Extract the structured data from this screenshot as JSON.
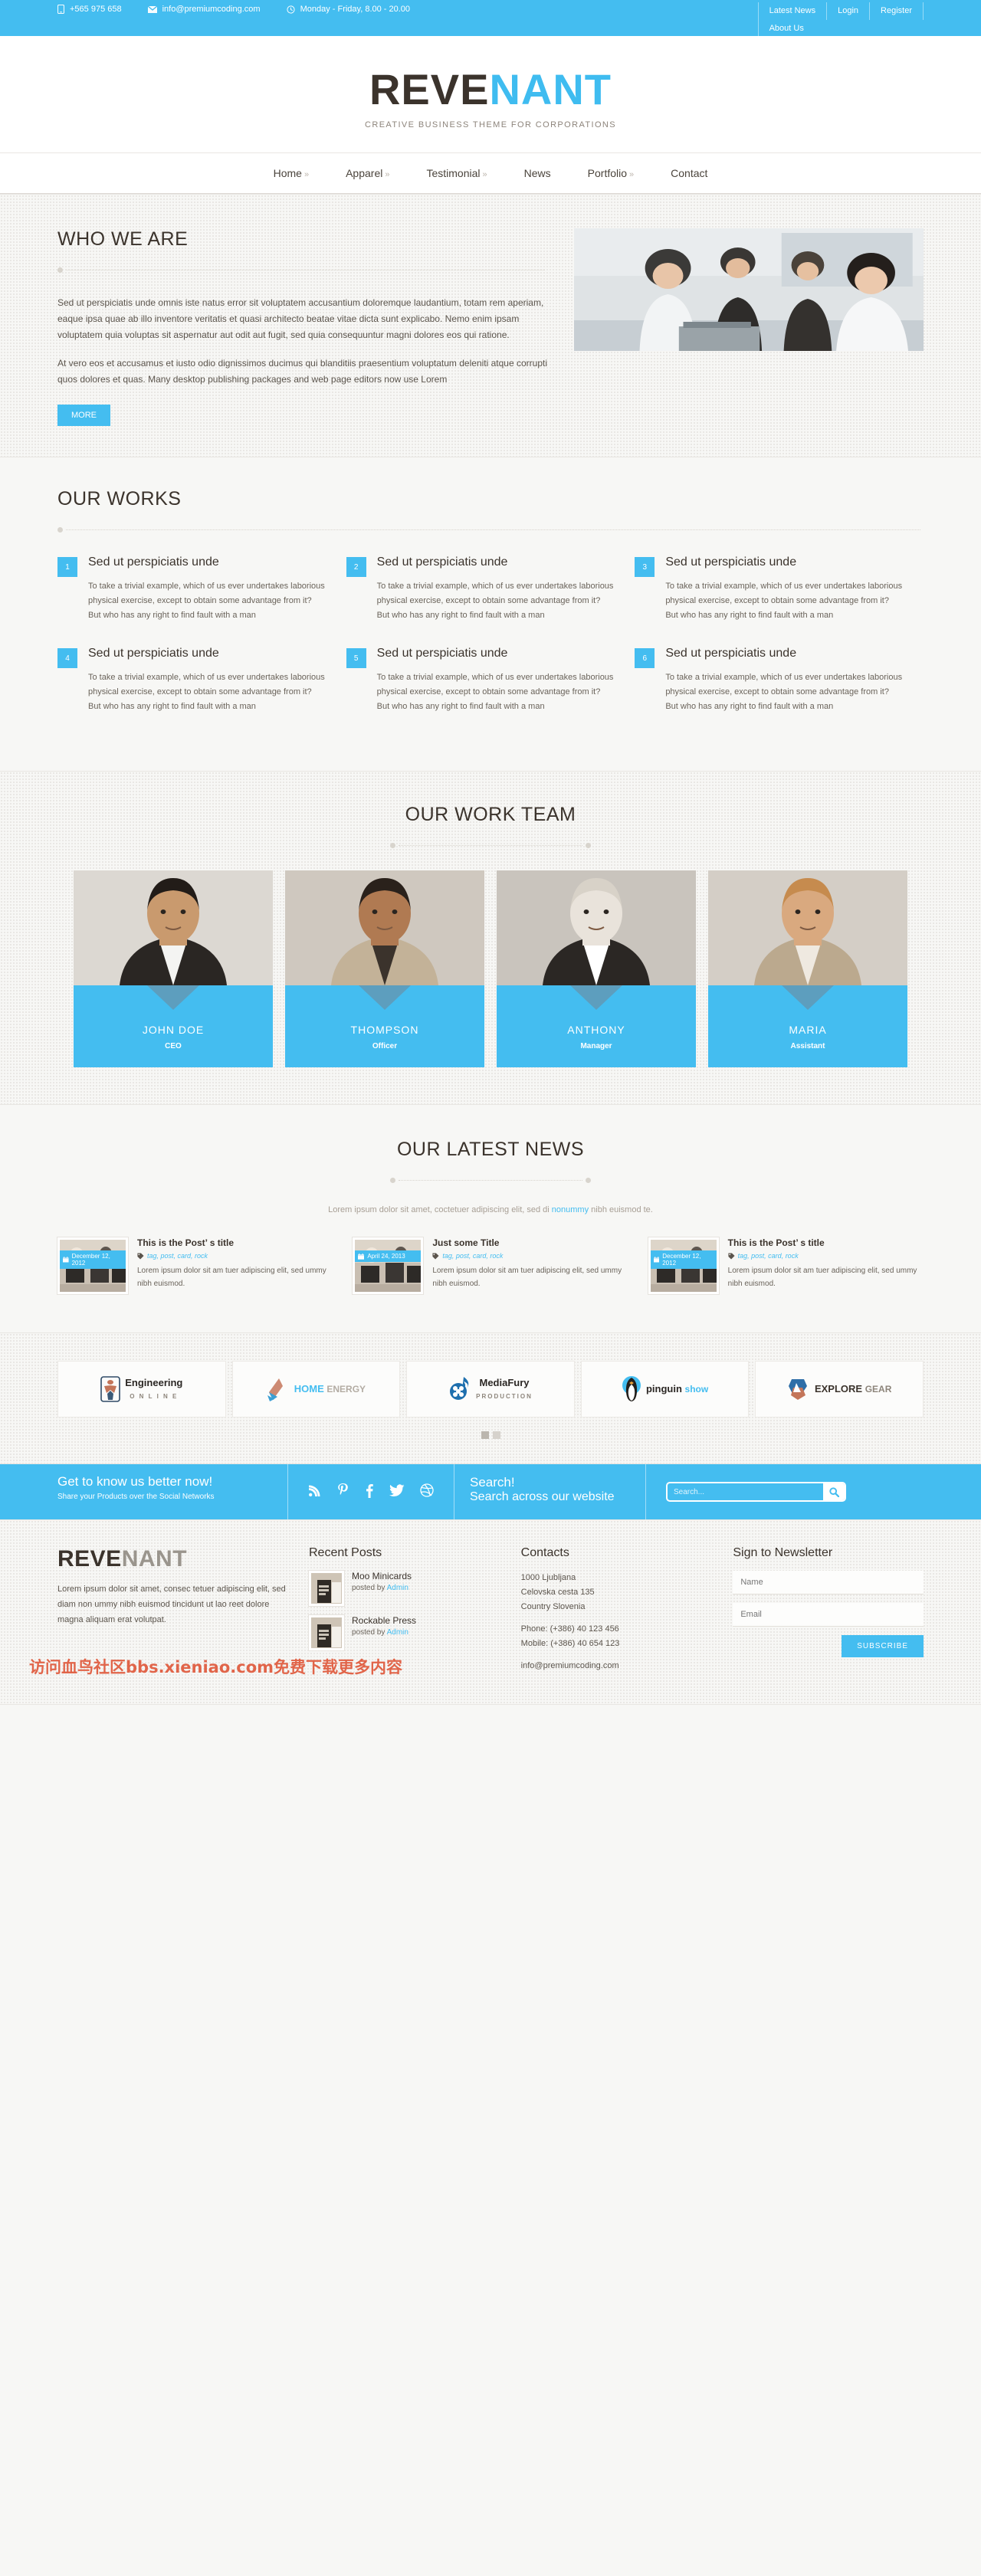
{
  "topbar": {
    "phone": "+565 975 658",
    "email": "info@premiumcoding.com",
    "hours": "Monday - Friday, 8.00 - 20.00",
    "links": [
      "Latest News",
      "Login",
      "Register"
    ],
    "links2": [
      "About Us"
    ]
  },
  "brand": {
    "part1": "REVE",
    "part2": "NANT",
    "tagline": "CREATIVE BUSINESS THEME FOR CORPORATIONS"
  },
  "nav": [
    {
      "label": "Home",
      "caret": "»"
    },
    {
      "label": "Apparel",
      "caret": "»"
    },
    {
      "label": "Testimonial",
      "caret": "»"
    },
    {
      "label": "News",
      "caret": ""
    },
    {
      "label": "Portfolio",
      "caret": "»"
    },
    {
      "label": "Contact",
      "caret": ""
    }
  ],
  "who": {
    "title": "WHO WE ARE",
    "p1": "Sed ut perspiciatis unde omnis iste natus error sit voluptatem accusantium doloremque laudantium, totam rem aperiam, eaque ipsa quae ab illo inventore veritatis et quasi architecto beatae vitae dicta sunt explicabo. Nemo enim ipsam voluptatem quia voluptas sit aspernatur aut odit aut fugit, sed quia consequuntur magni dolores eos qui ratione.",
    "p2": "At vero eos et accusamus et iusto odio dignissimos ducimus qui blanditiis praesentium voluptatum deleniti atque corrupti quos dolores et quas. Many desktop publishing packages and web page editors now use Lorem",
    "button": "MORE"
  },
  "works": {
    "title": "OUR WORKS",
    "items": [
      {
        "num": "1",
        "title": "Sed ut perspiciatis unde",
        "text": "To take a trivial example, which of us ever undertakes laborious physical exercise, except to obtain some advantage from it? But who has any right to find fault with a man"
      },
      {
        "num": "2",
        "title": "Sed ut perspiciatis unde",
        "text": "To take a trivial example, which of us ever undertakes laborious physical exercise, except to obtain some advantage from it? But who has any right to find fault with a man"
      },
      {
        "num": "3",
        "title": "Sed ut perspiciatis unde",
        "text": "To take a trivial example, which of us ever undertakes laborious physical exercise, except to obtain some advantage from it? But who has any right to find fault with a man"
      },
      {
        "num": "4",
        "title": "Sed ut perspiciatis unde",
        "text": "To take a trivial example, which of us ever undertakes laborious physical exercise, except to obtain some advantage from it? But who has any right to find fault with a man"
      },
      {
        "num": "5",
        "title": "Sed ut perspiciatis unde",
        "text": "To take a trivial example, which of us ever undertakes laborious physical exercise, except to obtain some advantage from it? But who has any right to find fault with a man"
      },
      {
        "num": "6",
        "title": "Sed ut perspiciatis unde",
        "text": "To take a trivial example, which of us ever undertakes laborious physical exercise, except to obtain some advantage from it? But who has any right to find fault with a man"
      }
    ]
  },
  "team": {
    "title": "OUR WORK TEAM",
    "members": [
      {
        "name": "JOHN DOE",
        "role": "CEO"
      },
      {
        "name": "THOMPSON",
        "role": "Officer"
      },
      {
        "name": "ANTHONY",
        "role": "Manager"
      },
      {
        "name": "MARIA",
        "role": "Assistant"
      }
    ]
  },
  "news": {
    "title": "OUR LATEST NEWS",
    "intro_before": "Lorem ipsum dolor sit amet, coctetuer adipiscing elit, sed di ",
    "intro_highlight": "nonummy",
    "intro_after": " nibh euismod te.",
    "posts": [
      {
        "date": "December 12, 2012",
        "title": "This is the Post’ s title",
        "tags": "tag,  post,  card,  rock",
        "text": "Lorem ipsum dolor sit am tuer adipiscing elit, sed ummy nibh euismod."
      },
      {
        "date": "April 24, 2013",
        "title": "Just some Title",
        "tags": "tag,  post,  card,  rock",
        "text": "Lorem ipsum dolor sit am tuer adipiscing elit, sed ummy nibh euismod."
      },
      {
        "date": "December 12, 2012",
        "title": "This is the Post’ s title",
        "tags": "tag,  post,  card,  rock",
        "text": "Lorem ipsum dolor sit am tuer adipiscing elit, sed ummy nibh euismod."
      }
    ]
  },
  "partners": [
    {
      "name": "Engineering",
      "sub": "O N L I N E"
    },
    {
      "name": "HOME",
      "sub": "ENERGY"
    },
    {
      "name": "MediaFury",
      "sub": "PRODUCTION"
    },
    {
      "name": "pinguin",
      "sub": "show"
    },
    {
      "name": "EXPLORE",
      "sub": "GEAR"
    }
  ],
  "cta": {
    "headline": "Get to know us better now!",
    "sub": "Share your Products over the Social Networks",
    "social": [
      "rss-icon",
      "pinterest-icon",
      "facebook-icon",
      "twitter-icon",
      "dribbble-icon"
    ],
    "search_title": "Search!",
    "search_sub": "Search across our website",
    "search_placeholder": "Search..."
  },
  "footer": {
    "brand1": "REVE",
    "brand2": "NANT",
    "desc": "Lorem ipsum dolor sit amet, consec tetuer adipiscing elit, sed diam non ummy nibh euismod tincidunt ut lao reet dolore magna aliquam erat volutpat.",
    "recent_title": "Recent Posts",
    "recent": [
      {
        "title": "Moo Minicards",
        "by_prefix": "posted by ",
        "by": "Admin"
      },
      {
        "title": "Rockable Press",
        "by_prefix": "posted by ",
        "by": "Admin"
      }
    ],
    "contacts_title": "Contacts",
    "addr": "1000 Ljubljana\nCelovska cesta 135\nCountry Slovenia",
    "phones": "Phone: (+386) 40 123 456\nMobile: (+386) 40 654 123",
    "email": "info@premiumcoding.com",
    "news_title": "Sign to Newsletter",
    "name_placeholder": "Name",
    "email_placeholder": "Email",
    "subscribe": "SUBSCRIBE",
    "watermark": "访问血鸟社区bbs.xieniao.com免费下载更多内容"
  },
  "colors": {
    "accent": "#44bdf0",
    "dark": "#3b332c",
    "bg": "#f7f7f5"
  }
}
